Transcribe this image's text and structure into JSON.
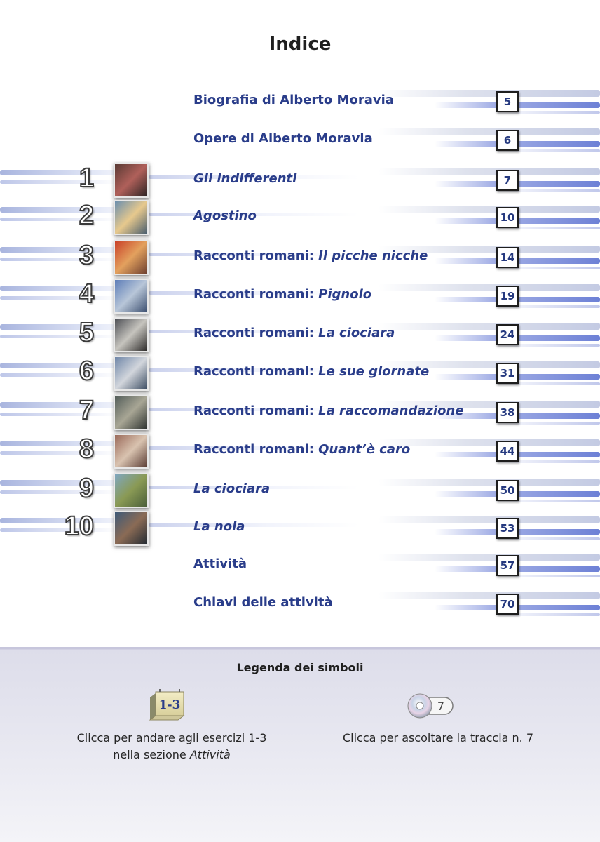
{
  "title": "Indice",
  "toc": [
    {
      "number": "",
      "parts": [
        {
          "text": "Biografia di Alberto Moravia",
          "italic": false
        }
      ],
      "page": "5",
      "thumb": null
    },
    {
      "number": "",
      "parts": [
        {
          "text": "Opere di Alberto Moravia",
          "italic": false
        }
      ],
      "page": "6",
      "thumb": null
    },
    {
      "number": "1",
      "parts": [
        {
          "text": "Gli indifferenti",
          "italic": true
        }
      ],
      "page": "7",
      "thumb": [
        "#5a3a34",
        "#b0605a",
        "#2d2424"
      ]
    },
    {
      "number": "2",
      "parts": [
        {
          "text": "Agostino",
          "italic": true
        }
      ],
      "page": "10",
      "thumb": [
        "#6b8fae",
        "#e7c98d",
        "#4a5e6e"
      ]
    },
    {
      "number": "3",
      "parts": [
        {
          "text": "Racconti romani: ",
          "italic": false
        },
        {
          "text": "Il picche nicche",
          "italic": true
        }
      ],
      "page": "14",
      "thumb": [
        "#c94128",
        "#e3a15e",
        "#6e4030"
      ]
    },
    {
      "number": "4",
      "parts": [
        {
          "text": "Racconti romani: ",
          "italic": false
        },
        {
          "text": "Pignolo",
          "italic": true
        }
      ],
      "page": "19",
      "thumb": [
        "#5d7db8",
        "#b8c6d8",
        "#3c4f70"
      ]
    },
    {
      "number": "5",
      "parts": [
        {
          "text": "Racconti romani: ",
          "italic": false
        },
        {
          "text": "La ciociara",
          "italic": true
        }
      ],
      "page": "24",
      "thumb": [
        "#4c4e54",
        "#c6c4be",
        "#2d2b2a"
      ]
    },
    {
      "number": "6",
      "parts": [
        {
          "text": "Racconti romani: ",
          "italic": false
        },
        {
          "text": "Le sue giornate",
          "italic": true
        }
      ],
      "page": "31",
      "thumb": [
        "#6f86a8",
        "#d2d6dc",
        "#3d4d63"
      ]
    },
    {
      "number": "7",
      "parts": [
        {
          "text": "Racconti romani: ",
          "italic": false
        },
        {
          "text": "La raccomandazione",
          "italic": true
        }
      ],
      "page": "38",
      "thumb": [
        "#545e5a",
        "#a8a695",
        "#2f3431"
      ]
    },
    {
      "number": "8",
      "parts": [
        {
          "text": "Racconti romani: ",
          "italic": false
        },
        {
          "text": "Quant’è caro",
          "italic": true
        }
      ],
      "page": "44",
      "thumb": [
        "#9a6a5a",
        "#d9c3b0",
        "#5b3d35"
      ]
    },
    {
      "number": "9",
      "parts": [
        {
          "text": "La ciociara",
          "italic": true
        }
      ],
      "page": "50",
      "thumb": [
        "#7fa7c0",
        "#8a9a55",
        "#4b5f3a"
      ]
    },
    {
      "number": "10",
      "parts": [
        {
          "text": "La noia",
          "italic": true
        }
      ],
      "page": "53",
      "thumb": [
        "#3e5a78",
        "#8b6b55",
        "#232b33"
      ]
    },
    {
      "number": "",
      "parts": [
        {
          "text": "Attività",
          "italic": false
        }
      ],
      "page": "57",
      "thumb": null
    },
    {
      "number": "",
      "parts": [
        {
          "text": "Chiavi delle attività",
          "italic": false
        }
      ],
      "page": "70",
      "thumb": null
    }
  ],
  "legend": {
    "title": "Legenda dei simboli",
    "exercise_icon_label": "1-3",
    "exercise_text_line1": "Clicca per andare agli esercizi 1-3",
    "exercise_text_line2_prefix": "nella sezione ",
    "exercise_text_line2_italic": "Attività",
    "track_icon_label": "7",
    "track_text": "Clicca per ascoltare la traccia n. 7"
  }
}
